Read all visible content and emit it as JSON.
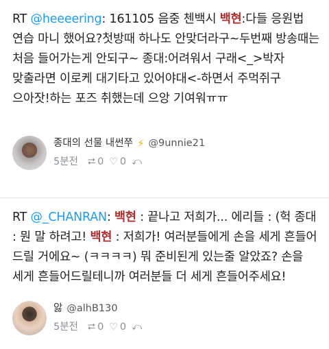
{
  "tweets": [
    {
      "rt_prefix": "RT ",
      "mention": "@heeeering",
      "segments": [
        {
          "text": ": 161105 음중 첸백시 ",
          "hl": false
        },
        {
          "text": "백현",
          "hl": true
        },
        {
          "text": ":다들 응원법 연습 마니 했어요?첫방때 하나도 안맞더라구~두번째 방송때는 처음 들어가는게 안되구~ 종대:어려워서 구래<_>박자 맞출라면 이로케 대기타고 있어야대<-하면서 주먹쥐구 으아잣!하는 포즈 취했는데 으앙 기여워ㅠㅠ",
          "hl": false
        }
      ],
      "author_name": "종대의 선물 내썬쭈",
      "author_badge": "⚡",
      "handle": "@9unnie21",
      "time": "5분전",
      "retweets": "0",
      "likes": "0"
    },
    {
      "rt_prefix": "RT ",
      "mention": "@_CHANRAN",
      "segments": [
        {
          "text": ": ",
          "hl": false
        },
        {
          "text": "백현",
          "hl": true
        },
        {
          "text": " : 끝나고 저희가... 에리들 : (헉 종대 : 뭔 말 하려고! ",
          "hl": false
        },
        {
          "text": "백현",
          "hl": true
        },
        {
          "text": " : 저희가! 여러분들에게 손을 세게 흔들어 드릴 거에요~ (ㅋㅋㅋㅋ) 뭐 준비된게 있는줄 알았죠? 손을 세게 흔들어드릴테니까 여러분들 더 세게 흔들어주세요!",
          "hl": false
        }
      ],
      "author_name": "앓",
      "author_badge": "",
      "handle": "@alhB130",
      "time": "5분전",
      "retweets": "0",
      "likes": "0"
    }
  ],
  "icons": {
    "retweet": "⮂",
    "heart": "♡",
    "reply": "⤺"
  },
  "colors": {
    "mention": "#1d9bf0",
    "highlight": "#b03030",
    "meta": "#8a8f95"
  }
}
